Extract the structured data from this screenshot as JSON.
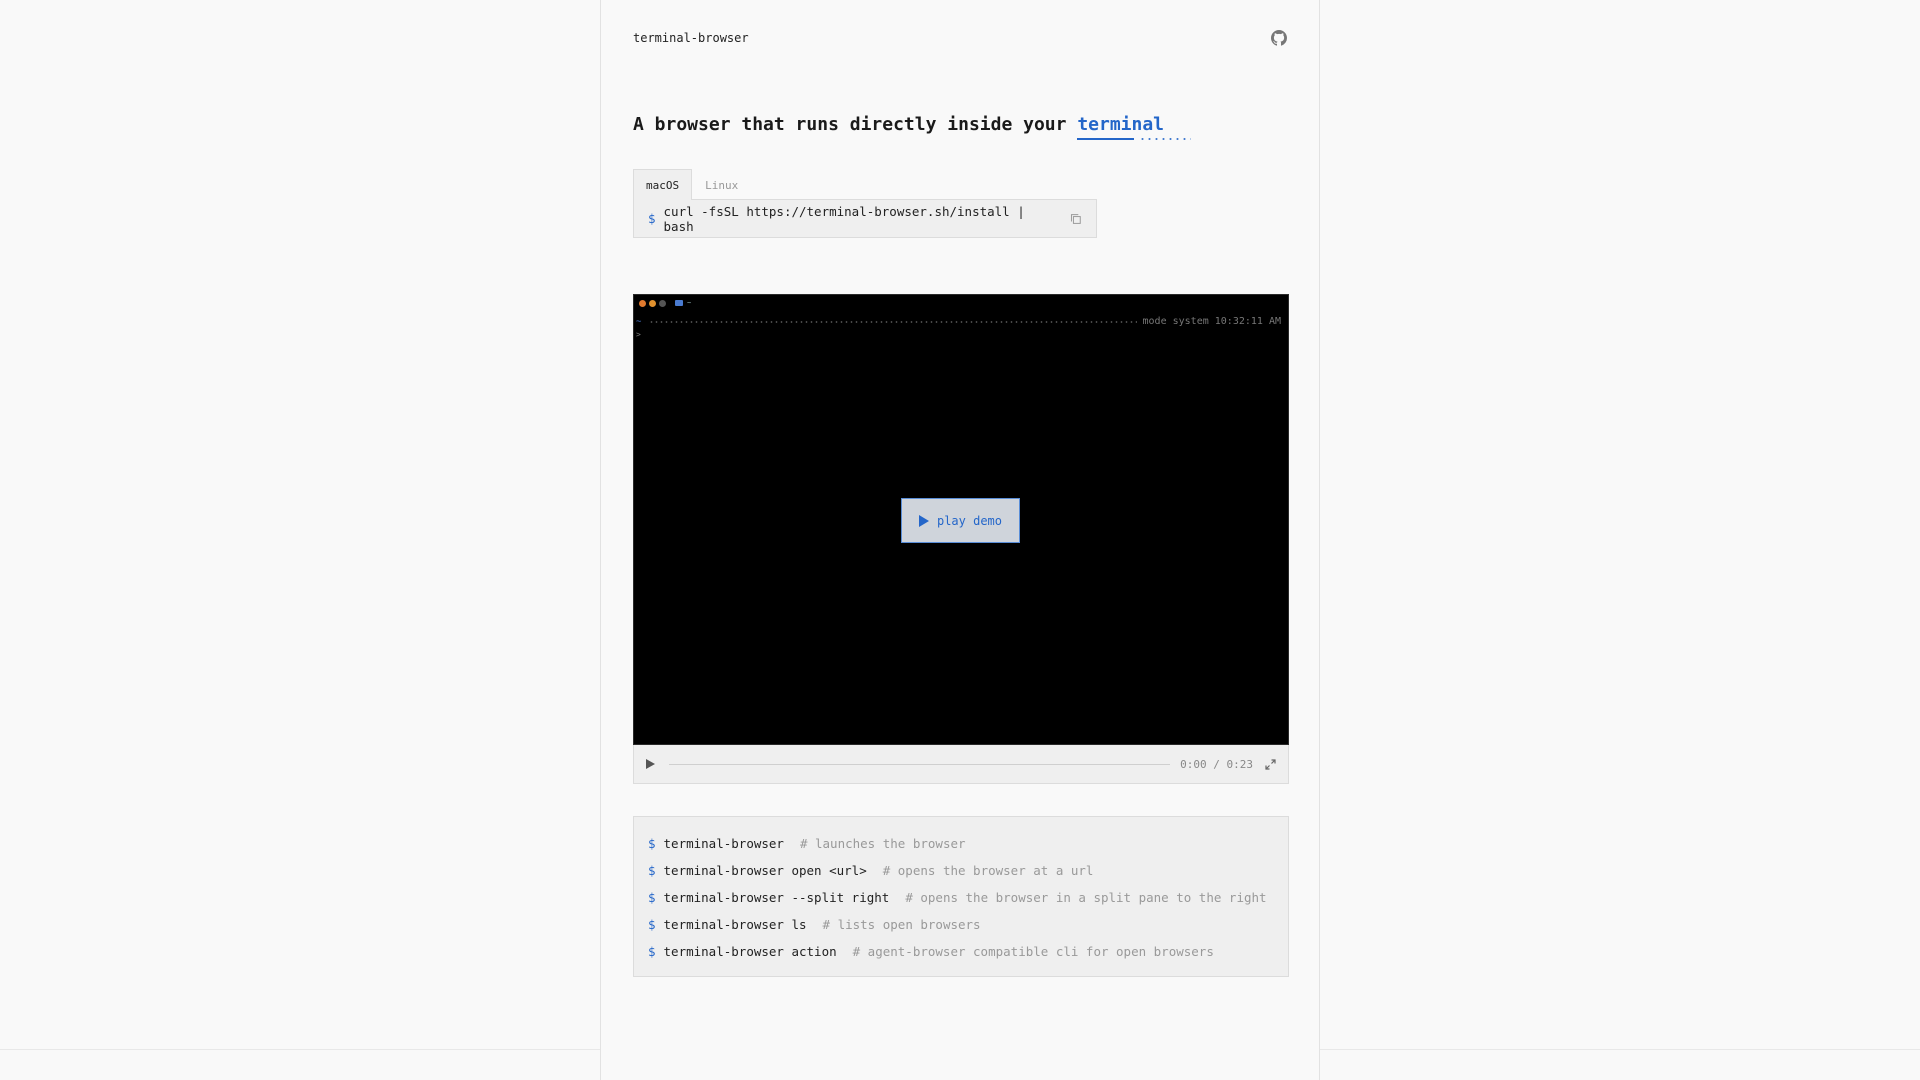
{
  "header": {
    "brand": "terminal-browser",
    "github_icon": "github-icon"
  },
  "hero": {
    "headline_prefix": "A browser that runs directly inside your",
    "headline_accent": "terminal"
  },
  "install": {
    "tabs": [
      {
        "label": "macOS",
        "active": true
      },
      {
        "label": "Linux",
        "active": false
      }
    ],
    "prompt": "$",
    "command": "curl -fsSL https://terminal-browser.sh/install | bash",
    "copy_icon": "copy-icon"
  },
  "player": {
    "terminal": {
      "folder_label": "~",
      "cwd": "~",
      "status": "mode system 10:32:11 AM",
      "prompt": ">"
    },
    "play_button_label": "play demo",
    "time": "0:00 / 0:23",
    "progress": 0
  },
  "usage": {
    "prompt": "$",
    "rows": [
      {
        "cmd": "terminal-browser",
        "comment": "# launches the browser"
      },
      {
        "cmd": "terminal-browser open <url>",
        "comment": "# opens the browser at a url"
      },
      {
        "cmd": "terminal-browser --split right",
        "comment": "# opens the browser in a split pane to the right"
      },
      {
        "cmd": "terminal-browser ls",
        "comment": "# lists open browsers"
      },
      {
        "cmd": "terminal-browser action",
        "comment": "# agent-browser compatible cli for open browsers"
      }
    ]
  },
  "colors": {
    "accent": "#2466c9",
    "background": "#f9f9f9",
    "panel": "#efefef",
    "terminal_bg": "#000000"
  }
}
